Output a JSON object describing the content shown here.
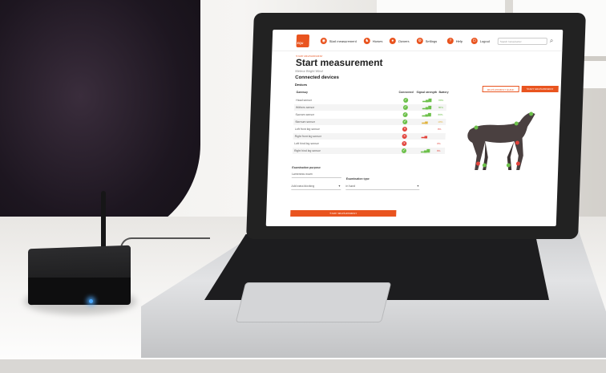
{
  "app": {
    "logo_text": "EQU",
    "nav": [
      {
        "label": "Start measurement",
        "icon": "horse-circle-icon"
      },
      {
        "label": "Horses",
        "icon": "horse-head-icon"
      },
      {
        "label": "Owners",
        "icon": "person-icon"
      },
      {
        "label": "Settings",
        "icon": "gear-icon"
      },
      {
        "label": "Help",
        "icon": "question-icon"
      },
      {
        "label": "Logout",
        "icon": "power-icon"
      }
    ],
    "search_placeholder": "Search horse/owner"
  },
  "page": {
    "breadcrumb": "START MEASUREMENT",
    "title": "Start measurement",
    "subtitle": "Meteor Bright Wind",
    "section_title": "Connected devices",
    "devices_label": "Devices",
    "btn_measurement_guide": "MEASUREMENT GUIDE",
    "btn_start_top": "START MEASUREMENT"
  },
  "devices_table": {
    "headers": [
      "Gateway",
      "Connected",
      "Signal strength",
      "Battery"
    ],
    "rows": [
      {
        "name": "Head sensor",
        "connected": true,
        "battery": "80%"
      },
      {
        "name": "Withers sensor",
        "connected": true,
        "battery": "80%"
      },
      {
        "name": "Sacrum sensor",
        "connected": true,
        "battery": "80%"
      },
      {
        "name": "Sternum sensor",
        "connected": true,
        "battery": "19%"
      },
      {
        "name": "Left front leg sensor",
        "connected": false,
        "battery": "0%"
      },
      {
        "name": "Right front leg sensor",
        "connected": false,
        "battery": ""
      },
      {
        "name": "Left hind leg sensor",
        "connected": false,
        "battery": "0%"
      },
      {
        "name": "Right hind leg sensor",
        "connected": true,
        "battery": "0%"
      }
    ]
  },
  "exam": {
    "purpose_label": "Examination purpose",
    "purpose_value": "Lameness exam",
    "type_label": "Examination type",
    "type_value": "In hand",
    "extra_value": "Add extra blocking",
    "start_label": "START MEASUREMENT"
  },
  "colors": {
    "accent": "#e9541f",
    "ok": "#6cc04a",
    "error": "#e2433c"
  }
}
